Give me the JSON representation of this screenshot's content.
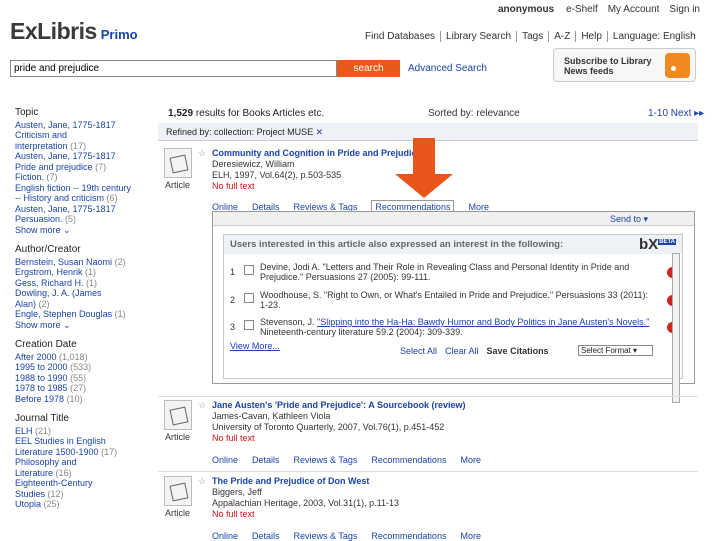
{
  "topbar": {
    "user": "anonymous",
    "links": [
      "e-Shelf",
      "My Account",
      "Sign in"
    ]
  },
  "logo": {
    "brand": "ExLibris",
    "product": "Primo"
  },
  "nav": [
    "Find Databases",
    "Library Search",
    "Tags",
    "A-Z",
    "Help",
    "Language: English"
  ],
  "search": {
    "value": "pride and prejudice",
    "button": "search",
    "advanced": "Advanced Search"
  },
  "subscribe": {
    "text": "Subscribe to Library News feeds",
    "icon": "rss-icon"
  },
  "facets": [
    {
      "title": "Topic",
      "items": [
        {
          "label": "Austen, Jane, 1775-1817",
          "count": ""
        },
        {
          "label": "Criticism and",
          "count": ""
        },
        {
          "label": "interpretation",
          "count": "(17)"
        },
        {
          "label": "Austen, Jane, 1775-1817",
          "count": ""
        },
        {
          "label": "Pride and prejudice",
          "count": "(7)"
        },
        {
          "label": "Fiction.",
          "count": "(7)"
        },
        {
          "label": "English fiction -- 19th century",
          "count": ""
        },
        {
          "label": "-- History and criticism",
          "count": "(6)"
        },
        {
          "label": "Austen, Jane, 1775-1817",
          "count": ""
        },
        {
          "label": "Persuasion.",
          "count": "(5)"
        },
        {
          "label": "Show more",
          "count": ""
        }
      ]
    },
    {
      "title": "Author/Creator",
      "items": [
        {
          "label": "Bernstein, Susan Naomi",
          "count": "(2)"
        },
        {
          "label": "Ergstrom, Henrik",
          "count": "(1)"
        },
        {
          "label": "Gess, Richard H.",
          "count": "(1)"
        },
        {
          "label": "Dowling, J. A. (James",
          "count": ""
        },
        {
          "label": "Alan)",
          "count": "(2)"
        },
        {
          "label": "Engle, Stephen Douglas",
          "count": "(1)"
        },
        {
          "label": "Show more",
          "count": ""
        }
      ]
    },
    {
      "title": "Creation Date",
      "items": [
        {
          "label": "After 2000",
          "count": "(1,018)"
        },
        {
          "label": "1995 to 2000",
          "count": "(533)"
        },
        {
          "label": "1988 to 1990",
          "count": "(55)"
        },
        {
          "label": "1978 to 1985",
          "count": "(27)"
        },
        {
          "label": "Before 1978",
          "count": "(10)"
        }
      ]
    },
    {
      "title": "Journal Title",
      "items": [
        {
          "label": "ELH",
          "count": "(21)"
        },
        {
          "label": "EEL Studies in English",
          "count": ""
        },
        {
          "label": "Literature 1500-1900",
          "count": "(17)"
        },
        {
          "label": "Philosophy and",
          "count": ""
        },
        {
          "label": "Literature",
          "count": "(16)"
        },
        {
          "label": "Eighteenth-Century",
          "count": ""
        },
        {
          "label": "Studies",
          "count": "(12)"
        },
        {
          "label": "Utopia",
          "count": "(25)"
        }
      ]
    }
  ],
  "results": {
    "count_prefix": "1,529",
    "count_suffix": "results for Books Articles etc.",
    "sort": "Sorted by: relevance",
    "pager": "1-10 Next ▸▸",
    "refined_label": "Refined by:",
    "refined_value": "collection: Project MUSE",
    "refined_x": "✕"
  },
  "records": [
    {
      "title": "Community and Cognition in Pride and Prejudice",
      "author": "Deresiewicz, William",
      "source": "ELH, 1997, Vol.64(2), p.503-535",
      "availability": "No full text",
      "type": "Article",
      "tabs": [
        "Online",
        "Details",
        "Reviews & Tags",
        "Recommendations",
        "More"
      ]
    },
    {
      "title": "Jane Austen's 'Pride and Prejudice': A Sourcebook (review)",
      "author": "James-Cavan, Kathleen Viola",
      "source": "University of Toronto Quarterly, 2007, Vol.76(1), p.451-452",
      "availability": "No full text",
      "type": "Article",
      "tabs": [
        "Online",
        "Details",
        "Reviews & Tags",
        "Recommendations",
        "More"
      ]
    },
    {
      "title": "The Pride and Prejudice of Don West",
      "author": "Biggers, Jeff",
      "source": "Appalachian Heritage, 2003, Vol.31(1), p.11-13",
      "availability": "No full text",
      "type": "Article",
      "tabs": [
        "Online",
        "Details",
        "Reviews & Tags",
        "Recommendations",
        "More"
      ]
    }
  ],
  "recommendations": {
    "send_to": "Send to ▾",
    "heading": "Users interested in this article also expressed an interest in the following:",
    "brand": "bX",
    "brand_tag": "BETA",
    "items": [
      {
        "n": "1",
        "pre": "Devine, Jodi A. \"Letters and Their Role in Revealing Class and Personal Identity in Pride and Prejudice.\" Persuasions 27 (2005): 99-111.",
        "link": "",
        "post": ""
      },
      {
        "n": "2",
        "pre": "Woodhouse, S. \"Right to Own, or What's Entailed in Pride and Prejudice.\" Persuasions 33 (2011): 1-23.",
        "link": "",
        "post": ""
      },
      {
        "n": "3",
        "pre": "Stevenson, J. ",
        "link": "\"Slipping into the Ha-Ha: Bawdy Humor and Body Politics in Jane Austen's Novels.\"",
        "post": " Nineteenth-century literature 59.2 (2004): 309-339."
      }
    ],
    "view_more": "View More...",
    "select_all": "Select All",
    "clear_all": "Clear All",
    "save_citations": "Save Citations",
    "select_format": "Select Format ▾"
  }
}
